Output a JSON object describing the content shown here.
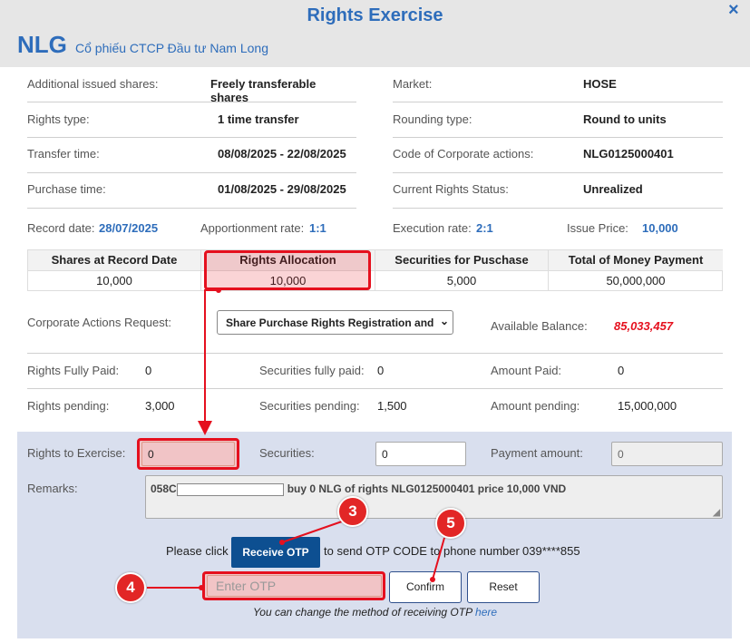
{
  "dialog": {
    "title": "Rights Exercise",
    "close_icon": "×",
    "ticker": "NLG",
    "company": "Cổ phiếu CTCP Đầu tư Nam Long"
  },
  "info_left": [
    {
      "label": "Additional issued shares:",
      "value": "Freely transferable shares"
    },
    {
      "label": "Rights type:",
      "value": "1 time transfer"
    },
    {
      "label": "Transfer time:",
      "value": "08/08/2025 - 22/08/2025"
    },
    {
      "label": "Purchase time:",
      "value": "01/08/2025 - 29/08/2025"
    }
  ],
  "info_right": [
    {
      "label": "Market:",
      "value": "HOSE"
    },
    {
      "label": "Rounding type:",
      "value": "Round to units"
    },
    {
      "label": "Code of Corporate actions:",
      "value": "NLG0125000401"
    },
    {
      "label": "Current Rights Status:",
      "value": "Unrealized"
    }
  ],
  "rates": {
    "record_date_label": "Record date:",
    "record_date": "28/07/2025",
    "apportion_label": "Apportionment rate:",
    "apportion": "1:1",
    "execution_label": "Execution rate:",
    "execution": "2:1",
    "issue_price_label": "Issue Price:",
    "issue_price": "10,000"
  },
  "summary_table": {
    "headers": [
      "Shares at Record Date",
      "Rights Allocation",
      "Securities for Puschase",
      "Total of Money Payment"
    ],
    "values": [
      "10,000",
      "10,000",
      "5,000",
      "50,000,000"
    ]
  },
  "request": {
    "label": "Corporate Actions Request:",
    "selected": "Share Purchase Rights Registration and",
    "balance_label": "Available Balance:",
    "balance": "85,033,457"
  },
  "status": {
    "fully_paid_label": "Rights Fully Paid:",
    "fully_paid": "0",
    "sec_fully_paid_label": "Securities fully paid:",
    "sec_fully_paid": "0",
    "amount_paid_label": "Amount Paid:",
    "amount_paid": "0",
    "pending_label": "Rights pending:",
    "pending": "3,000",
    "sec_pending_label": "Securities pending:",
    "sec_pending": "1,500",
    "amount_pending_label": "Amount pending:",
    "amount_pending": "15,000,000"
  },
  "form": {
    "rights_label": "Rights to Exercise:",
    "rights_value": "0",
    "securities_label": "Securities:",
    "securities_value": "0",
    "payment_label": "Payment amount:",
    "payment_value": "0",
    "remarks_label": "Remarks:",
    "remarks_prefix": "058C",
    "remarks_suffix": "buy 0 NLG of rights NLG0125000401 price 10,000 VND",
    "otp_before": "Please click",
    "otp_button": "Receive OTP",
    "otp_after": "to send OTP CODE to phone number",
    "phone": "039****855",
    "otp_placeholder": "Enter OTP",
    "confirm": "Confirm",
    "reset": "Reset",
    "change_note": "You can change the method of receiving OTP",
    "here": "here"
  },
  "annotations": {
    "step3": "3",
    "step4": "4",
    "step5": "5"
  },
  "colors": {
    "brand": "#2e6dbb",
    "highlight": "#e5101e",
    "button": "#0d4f91",
    "panel": "#d9dfee"
  }
}
